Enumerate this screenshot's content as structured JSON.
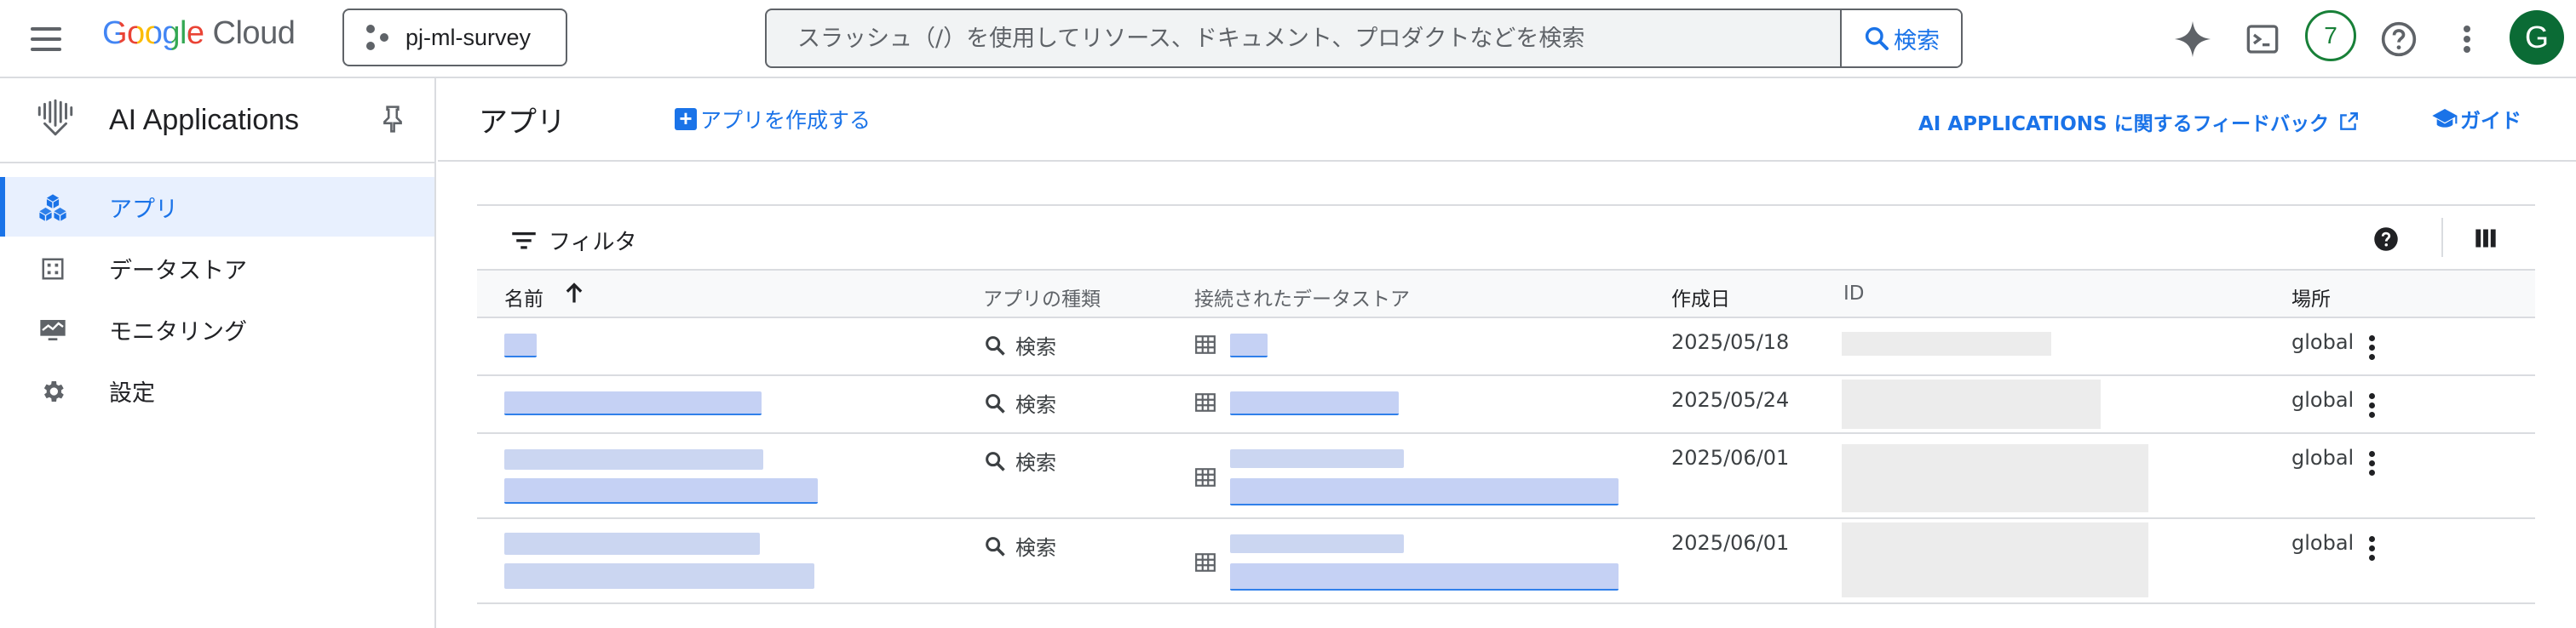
{
  "topbar": {
    "logo_google": "Google",
    "logo_cloud": "Cloud",
    "project": "pj-ml-survey",
    "search_placeholder": "スラッシュ（/）を使用してリソース、ドキュメント、プロダクトなどを検索",
    "search_button": "検索",
    "notification_count": "7",
    "avatar_initial": "G"
  },
  "sidebar": {
    "product_title": "AI Applications",
    "items": [
      {
        "label": "アプリ",
        "icon": "apps-cube-icon",
        "active": true
      },
      {
        "label": "データストア",
        "icon": "datastore-icon",
        "active": false
      },
      {
        "label": "モニタリング",
        "icon": "monitoring-icon",
        "active": false
      },
      {
        "label": "設定",
        "icon": "gear-icon",
        "active": false
      }
    ]
  },
  "main": {
    "title": "アプリ",
    "create_button": "アプリを作成する",
    "feedback_link": "AI APPLICATIONS に関するフィードバック",
    "guide_link": "ガイド",
    "filter_label": "フィルタ",
    "columns": {
      "name": "名前",
      "type": "アプリの種類",
      "datastore": "接続されたデータストア",
      "created": "作成日",
      "id": "ID",
      "location": "場所"
    },
    "rows": [
      {
        "type": "検索",
        "created": "2025/05/18",
        "location": "global"
      },
      {
        "type": "検索",
        "created": "2025/05/24",
        "location": "global"
      },
      {
        "type": "検索",
        "created": "2025/06/01",
        "location": "global"
      },
      {
        "type": "検索",
        "created": "2025/06/01",
        "location": "global"
      }
    ]
  },
  "colors": {
    "accent": "#1a73e8",
    "active_bg": "#e8f0fe",
    "border": "#dadce0",
    "badge_green": "#188038",
    "avatar_bg": "#0b6b35"
  }
}
